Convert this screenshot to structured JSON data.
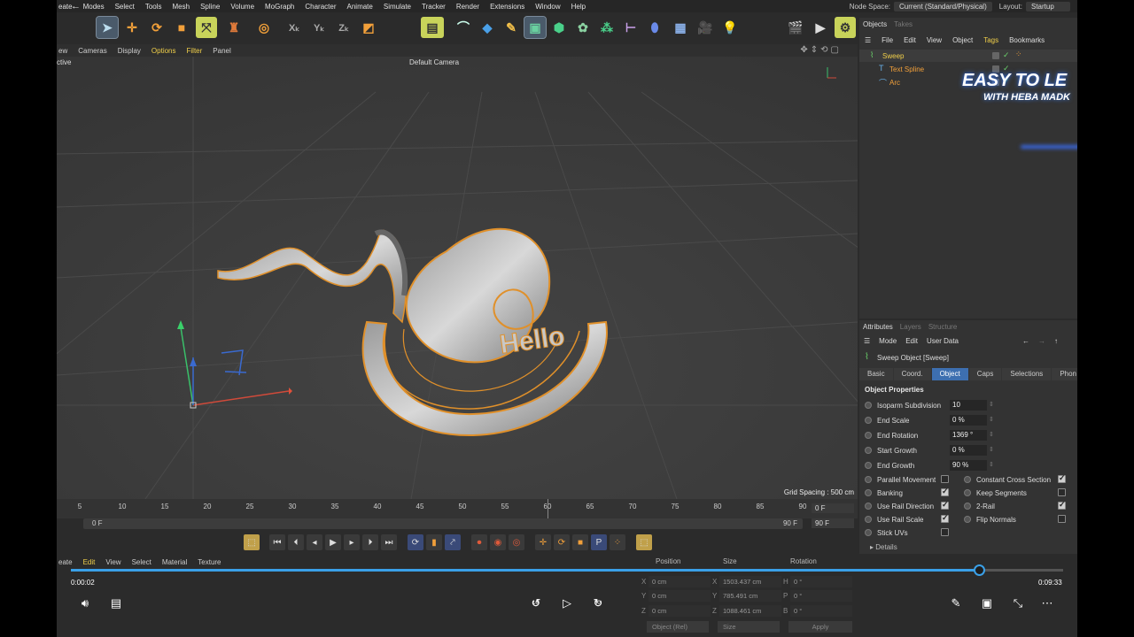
{
  "menubar": {
    "items": [
      "eate",
      "Modes",
      "Select",
      "Tools",
      "Mesh",
      "Spline",
      "Volume",
      "MoGraph",
      "Character",
      "Animate",
      "Simulate",
      "Tracker",
      "Render",
      "Extensions",
      "Window",
      "Help"
    ],
    "node_space_label": "Node Space:",
    "node_space_value": "Current (Standard/Physical)",
    "layout_label": "Layout:",
    "layout_value": "Startup"
  },
  "viewport": {
    "menu": [
      "ew",
      "Cameras",
      "Display",
      "Options",
      "Filter",
      "Panel"
    ],
    "active_menu": "Options",
    "left_label": "ctive",
    "camera_label": "Default Camera",
    "grid_spacing": "Grid Spacing : 500 cm",
    "model_text": "Hello"
  },
  "timeline": {
    "ticks": [
      "5",
      "10",
      "15",
      "20",
      "25",
      "30",
      "35",
      "40",
      "45",
      "50",
      "55",
      "60",
      "65",
      "70",
      "75",
      "80",
      "85",
      "90"
    ],
    "current_frame": "0 F",
    "range_start": "0 F",
    "range_end": "90 F",
    "end_frame": "90 F"
  },
  "bottom_menu": [
    "eate",
    "Edit",
    "View",
    "Select",
    "Material",
    "Texture"
  ],
  "coords": {
    "headers": [
      "Position",
      "Size",
      "Rotation"
    ],
    "rows": [
      {
        "axis": "X",
        "pos": "0 cm",
        "size_axis": "X",
        "size": "1503.437 cm",
        "rot_axis": "H",
        "rot": "0 °"
      },
      {
        "axis": "Y",
        "pos": "0 cm",
        "size_axis": "Y",
        "size": "785.491 cm",
        "rot_axis": "P",
        "rot": "0 °"
      },
      {
        "axis": "Z",
        "pos": "0 cm",
        "size_axis": "Z",
        "size": "1088.461 cm",
        "rot_axis": "B",
        "rot": "0 °"
      }
    ],
    "mode": "Object (Rel)",
    "size_mode": "Size",
    "apply": "Apply"
  },
  "video": {
    "elapsed": "0:00:02",
    "total": "0:09:33",
    "progress": 0.915,
    "skip_back": "10",
    "skip_fwd": "30",
    "accent": "#3aa0e8"
  },
  "objects": {
    "tabs": [
      "Objects",
      "Takes"
    ],
    "menu": [
      "File",
      "Edit",
      "View",
      "Object",
      "Tags",
      "Bookmarks"
    ],
    "items": [
      {
        "name": "Sweep",
        "color": "#f2d04a"
      },
      {
        "name": "Text Spline",
        "color": "#f2a03a"
      },
      {
        "name": "Arc",
        "color": "#f2a03a"
      }
    ],
    "banner_line1": "EASY TO LE",
    "banner_line2": "WITH HEBA MADK"
  },
  "attributes": {
    "tabs": [
      "Attributes",
      "Layers",
      "Structure"
    ],
    "menu": [
      "Mode",
      "Edit",
      "User Data"
    ],
    "title": "Sweep Object [Sweep]",
    "subtabs": [
      "Basic",
      "Coord.",
      "Object",
      "Caps",
      "Selections",
      "Phon"
    ],
    "active_subtab": "Object",
    "section": "Object Properties",
    "props": [
      {
        "label": "Isoparm Subdivision",
        "value": "10"
      },
      {
        "label": "End Scale",
        "value": "0 %"
      },
      {
        "label": "End Rotation",
        "value": "1369 °"
      },
      {
        "label": "Start Growth",
        "value": "0 %"
      },
      {
        "label": "End Growth",
        "value": "90 %"
      }
    ],
    "checks_left": [
      {
        "label": "Parallel Movement",
        "checked": false
      },
      {
        "label": "Banking",
        "checked": true
      },
      {
        "label": "Use Rail Direction",
        "checked": true
      },
      {
        "label": "Use Rail Scale",
        "checked": true
      },
      {
        "label": "Stick UVs",
        "checked": false
      }
    ],
    "checks_right": [
      {
        "label": "Constant Cross Section",
        "checked": true
      },
      {
        "label": "Keep Segments",
        "checked": false
      },
      {
        "label": "2-Rail",
        "checked": true
      },
      {
        "label": "Flip Normals",
        "checked": false
      }
    ],
    "details": "Details"
  }
}
